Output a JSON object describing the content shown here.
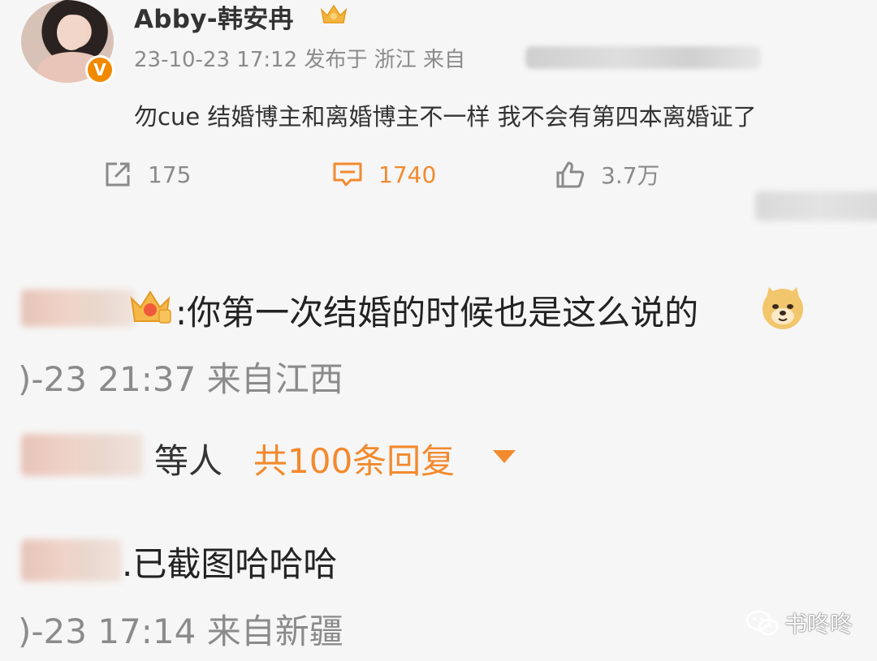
{
  "post": {
    "username": "Abby-韩安冉",
    "meta": "23-10-23 17:12 发布于 浙江 来自",
    "text": "勿cue 结婚博主和离婚博主不一样 我不会有第四本离婚证了",
    "forward_count": "175",
    "comment_count": "1740",
    "like_count": "3.7万"
  },
  "comment1": {
    "text": ":你第一次结婚的时候也是这么说的",
    "meta": ")-23 21:37 来自江西"
  },
  "replies": {
    "who": "等人",
    "count_label": "共100条回复"
  },
  "comment2": {
    "text": ".已截图哈哈哈",
    "meta": ")-23 17:14 来自新疆"
  },
  "watermark": {
    "text": "书咚咚",
    "icon": "wechat-icon"
  },
  "colors": {
    "accent": "#f28a2e",
    "meta_gray": "#8b8b8b",
    "verified_badge": "#f08a00"
  }
}
